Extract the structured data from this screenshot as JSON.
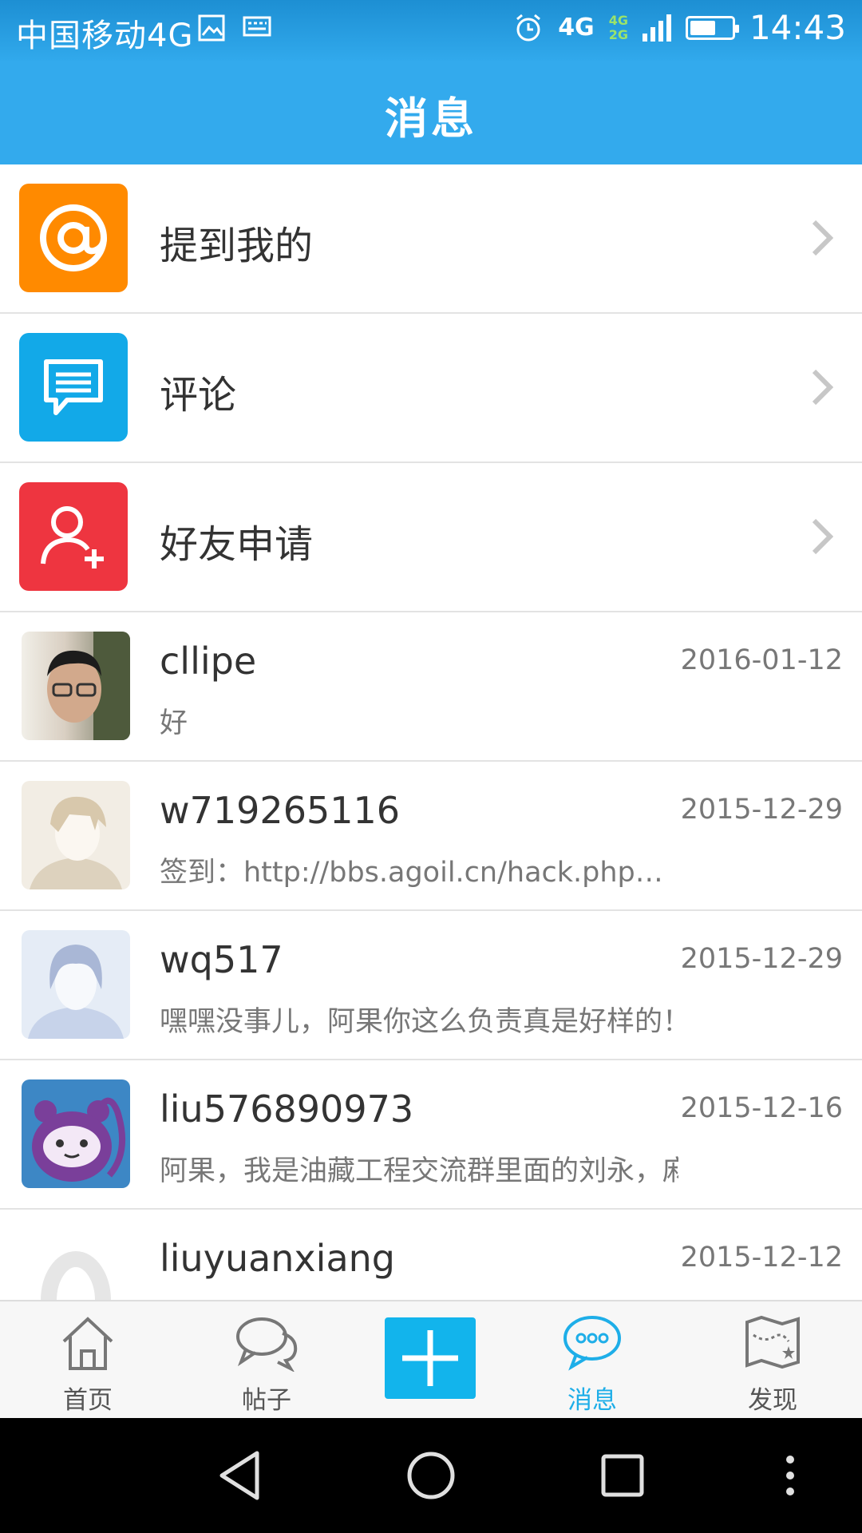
{
  "status_bar": {
    "carrier": "中国移动4G",
    "network_primary": "4G",
    "network_secondary": [
      "4G",
      "2G"
    ],
    "time": "14:43",
    "battery_level": 0.55
  },
  "header": {
    "title": "消息"
  },
  "categories": [
    {
      "label": "提到我的",
      "icon": "at-sign-icon",
      "color": "#ff8a00"
    },
    {
      "label": "评论",
      "icon": "comment-icon",
      "color": "#12a9e8"
    },
    {
      "label": "好友申请",
      "icon": "add-friend-icon",
      "color": "#ee3540"
    }
  ],
  "messages": [
    {
      "name": "cllipe",
      "date": "2016-01-12",
      "preview": "好"
    },
    {
      "name": "w719265116",
      "date": "2015-12-29",
      "preview": "签到：http://bbs.agoil.cn/hack.php…"
    },
    {
      "name": "wq517",
      "date": "2015-12-29",
      "preview": "嘿嘿没事儿，阿果你这么负责真是好样的！"
    },
    {
      "name": "liu576890973",
      "date": "2015-12-16",
      "preview": "阿果，我是油藏工程交流群里面的刘永，麻烦您尽…"
    },
    {
      "name": "liuyuanxiang",
      "date": "2015-12-12",
      "preview": ""
    }
  ],
  "tab_bar": {
    "tabs": [
      {
        "label": "首页",
        "icon": "home-icon"
      },
      {
        "label": "帖子",
        "icon": "posts-icon"
      },
      {
        "label": "",
        "icon": "plus-icon"
      },
      {
        "label": "消息",
        "icon": "messages-icon",
        "active": true
      },
      {
        "label": "发现",
        "icon": "discover-map-icon"
      }
    ]
  },
  "colors": {
    "primary": "#33aaed",
    "active_tab": "#1eaee8"
  }
}
